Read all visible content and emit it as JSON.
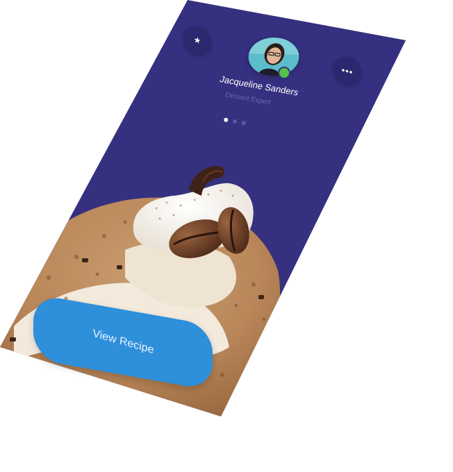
{
  "profile": {
    "name": "Jacqueline Sanders",
    "role": "Dessert Expert",
    "status": "online"
  },
  "header": {
    "star_icon": "★",
    "more_icon": "•••"
  },
  "pager": {
    "total": 3,
    "active": 1
  },
  "cta": {
    "label": "View Recipe"
  },
  "colors": {
    "background": "#35307f",
    "button": "#2e8fda",
    "online": "#56c14a"
  }
}
